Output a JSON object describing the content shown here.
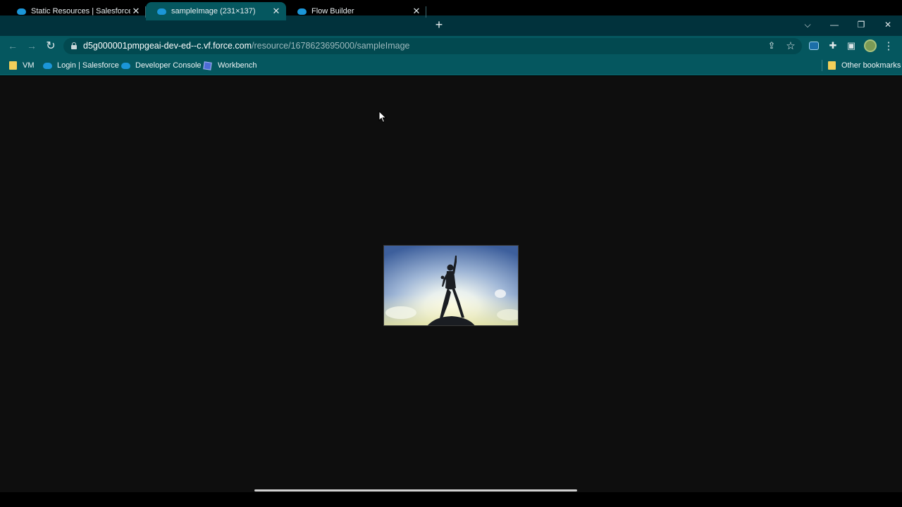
{
  "tabs": [
    {
      "title": "Static Resources | Salesforce",
      "favicon": "salesforce-cloud-icon",
      "active": false
    },
    {
      "title": "sampleImage (231×137)",
      "favicon": "salesforce-cloud-icon",
      "active": true
    },
    {
      "title": "Flow Builder",
      "favicon": "salesforce-cloud-icon",
      "active": false
    }
  ],
  "tab_close_glyph": "✕",
  "new_tab_glyph": "+",
  "window_controls": {
    "tab_search": "⌵",
    "minimize": "—",
    "restore": "❐",
    "close": "✕"
  },
  "address_bar": {
    "host": "d5g000001pmpgeai-dev-ed--c.vf.force.com",
    "path": "/resource/1678623695000/sampleImage"
  },
  "nav": {
    "back": "←",
    "forward": "→",
    "reload": "↻"
  },
  "toolbar_icons": {
    "share": "⇪",
    "bookmark_star": "☆",
    "extensions": "✚",
    "side_panel": "▣",
    "menu": "⋮"
  },
  "bookmarks": [
    {
      "label": "VM",
      "icon": "folder-icon"
    },
    {
      "label": "Login | Salesforce",
      "icon": "salesforce-cloud-icon"
    },
    {
      "label": "Developer Console",
      "icon": "salesforce-cloud-icon"
    },
    {
      "label": "Workbench",
      "icon": "workbench-cube-icon"
    }
  ],
  "other_bookmarks": "Other bookmarks",
  "theme": {
    "tabstrip": "#01323c",
    "toolbar": "#05575f",
    "content_bg": "#0e0e0e",
    "favicon_blue": "#1b96d8"
  }
}
